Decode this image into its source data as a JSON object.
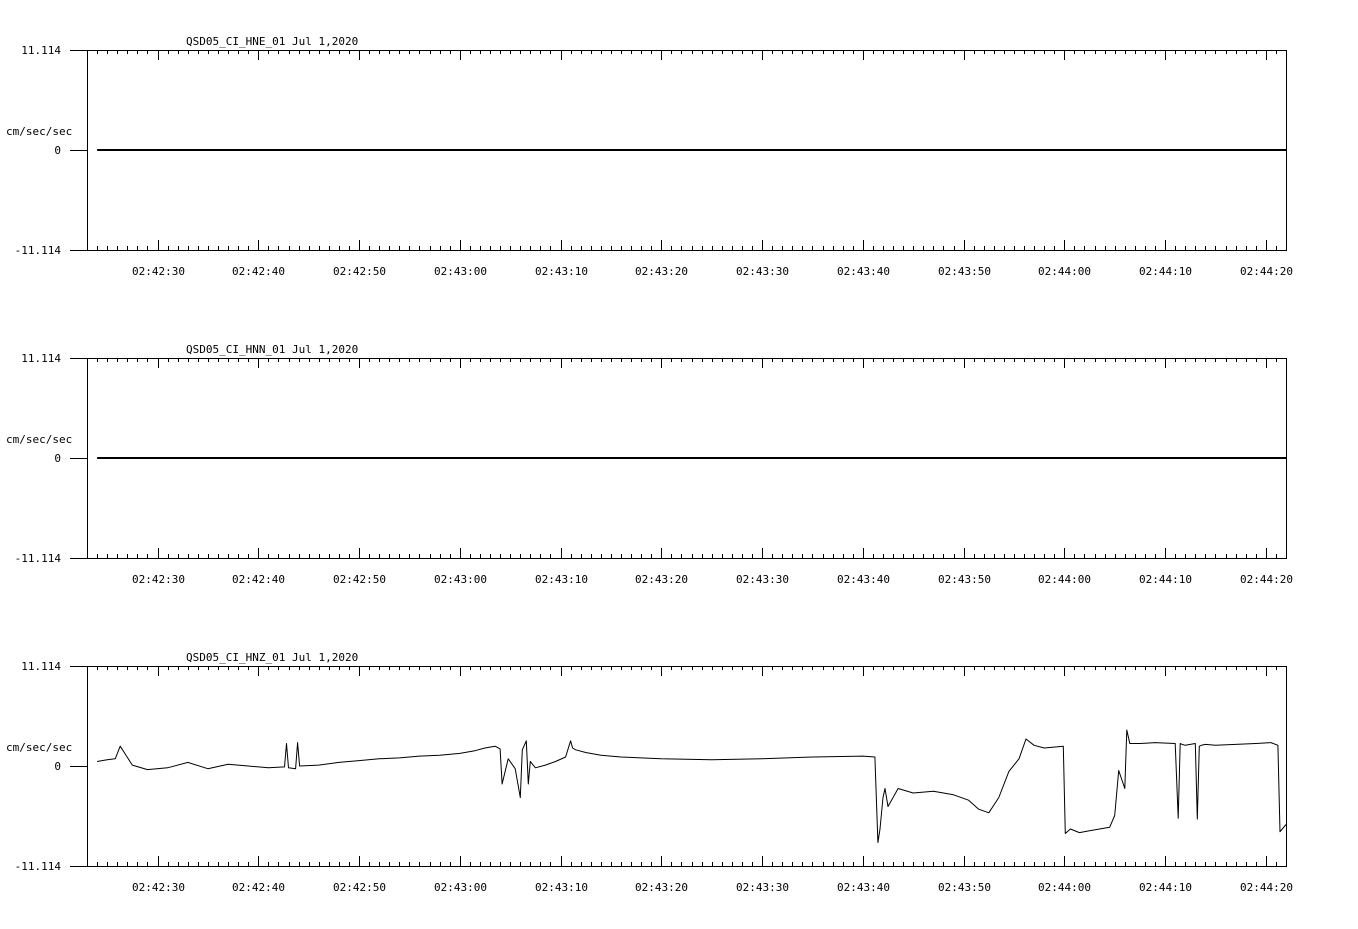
{
  "chart_data": [
    {
      "type": "line",
      "title": "QSD05_CI_HNE_01  Jul 1,2020",
      "ylabel": "cm/sec/sec",
      "ylim": [
        -11.114,
        11.114
      ],
      "ytick_labels": [
        "11.114",
        "0",
        "-11.114"
      ],
      "xlim": [
        "02:42:23",
        "02:44:22"
      ],
      "xtick_labels": [
        "02:42:30",
        "02:42:40",
        "02:42:50",
        "02:43:00",
        "02:43:10",
        "02:43:20",
        "02:43:30",
        "02:43:40",
        "02:43:50",
        "02:44:00",
        "02:44:10",
        "02:44:20"
      ],
      "grid": false,
      "series": [
        {
          "x": [
            "02:42:24",
            "02:44:22"
          ],
          "y": [
            0,
            0
          ]
        }
      ]
    },
    {
      "type": "line",
      "title": "QSD05_CI_HNN_01  Jul 1,2020",
      "ylabel": "cm/sec/sec",
      "ylim": [
        -11.114,
        11.114
      ],
      "ytick_labels": [
        "11.114",
        "0",
        "-11.114"
      ],
      "xlim": [
        "02:42:23",
        "02:44:22"
      ],
      "xtick_labels": [
        "02:42:30",
        "02:42:40",
        "02:42:50",
        "02:43:00",
        "02:43:10",
        "02:43:20",
        "02:43:30",
        "02:43:40",
        "02:43:50",
        "02:44:00",
        "02:44:10",
        "02:44:20"
      ],
      "grid": false,
      "series": [
        {
          "x": [
            "02:42:24",
            "02:44:22"
          ],
          "y": [
            0,
            0
          ]
        }
      ]
    },
    {
      "type": "line",
      "title": "QSD05_CI_HNZ_01  Jul 1,2020",
      "ylabel": "cm/sec/sec",
      "ylim": [
        -11.114,
        11.114
      ],
      "ytick_labels": [
        "11.114",
        "0",
        "-11.114"
      ],
      "xlim": [
        "02:42:23",
        "02:44:22"
      ],
      "xtick_labels": [
        "02:42:30",
        "02:42:40",
        "02:42:50",
        "02:43:00",
        "02:43:10",
        "02:43:20",
        "02:43:30",
        "02:43:40",
        "02:43:50",
        "02:44:00",
        "02:44:10",
        "02:44:20"
      ],
      "grid": false,
      "series": [
        {
          "x": [
            "02:42:24.0",
            "02:42:25.0",
            "02:42:25.8",
            "02:42:26.3",
            "02:42:27.5",
            "02:42:29",
            "02:42:31",
            "02:42:33",
            "02:42:35",
            "02:42:37",
            "02:42:39",
            "02:42:41",
            "02:42:42.6",
            "02:42:42.8",
            "02:42:43.0",
            "02:42:43.7",
            "02:42:43.9",
            "02:42:44.1",
            "02:42:46",
            "02:42:48",
            "02:42:50",
            "02:42:52",
            "02:42:54",
            "02:42:56",
            "02:42:58",
            "02:43:00",
            "02:43:01.5",
            "02:43:02.5",
            "02:43:03.5",
            "02:43:04.0",
            "02:43:04.2",
            "02:43:04.8",
            "02:43:05.5",
            "02:43:06.0",
            "02:43:06.2",
            "02:43:06.6",
            "02:43:06.8",
            "02:43:07.0",
            "02:43:07.5",
            "02:43:08.5",
            "02:43:09.5",
            "02:43:10.5",
            "02:43:11.0",
            "02:43:11.2",
            "02:43:11.5",
            "02:43:12.5",
            "02:43:14.0",
            "02:43:16",
            "02:43:20",
            "02:43:25",
            "02:43:30",
            "02:43:35",
            "02:43:40",
            "02:43:41.2",
            "02:43:41.5",
            "02:43:41.7",
            "02:43:42.0",
            "02:43:42.2",
            "02:43:42.5",
            "02:43:43.5",
            "02:43:45",
            "02:43:47",
            "02:43:49",
            "02:43:50.5",
            "02:43:51.5",
            "02:43:52.5",
            "02:43:53.5",
            "02:43:54.5",
            "02:43:55.5",
            "02:43:56.2",
            "02:43:57",
            "02:43:58",
            "02:43:59.9",
            "02:44:00.1",
            "02:44:00.6",
            "02:44:01.5",
            "02:44:02.5",
            "02:44:03.5",
            "02:44:04.5",
            "02:44:05.0",
            "02:44:05.4",
            "02:44:06.0",
            "02:44:06.2",
            "02:44:06.5",
            "02:44:07.5",
            "02:44:09",
            "02:44:11",
            "02:44:11.3",
            "02:44:11.5",
            "02:44:11.7",
            "02:44:12",
            "02:44:13",
            "02:44:13.2",
            "02:44:13.4",
            "02:44:13.6",
            "02:44:14",
            "02:44:15",
            "02:44:17",
            "02:44:19",
            "02:44:20.5",
            "02:44:21.2",
            "02:44:21.4",
            "02:44:22.0"
          ],
          "y": [
            0.5,
            0.7,
            0.8,
            2.2,
            0.1,
            -0.4,
            -0.2,
            0.4,
            -0.3,
            0.2,
            0.0,
            -0.2,
            -0.1,
            2.5,
            -0.2,
            -0.3,
            2.6,
            0.0,
            0.1,
            0.4,
            0.6,
            0.8,
            0.9,
            1.1,
            1.2,
            1.4,
            1.7,
            2.0,
            2.2,
            1.9,
            -2.0,
            0.8,
            -0.3,
            -3.5,
            1.8,
            2.8,
            -2.0,
            0.5,
            -0.2,
            0.1,
            0.5,
            1.0,
            2.8,
            2.0,
            1.8,
            1.5,
            1.2,
            1.0,
            0.8,
            0.7,
            0.8,
            1.0,
            1.1,
            1.0,
            -8.5,
            -7.0,
            -3.5,
            -2.5,
            -4.5,
            -2.5,
            -3.0,
            -2.8,
            -3.2,
            -3.8,
            -4.8,
            -5.2,
            -3.5,
            -0.6,
            0.8,
            3.0,
            2.3,
            2.0,
            2.2,
            -7.5,
            -7.0,
            -7.4,
            -7.2,
            -7.0,
            -6.8,
            -5.5,
            -0.5,
            -2.5,
            4.0,
            2.5,
            2.5,
            2.6,
            2.5,
            -5.8,
            2.5,
            2.4,
            2.3,
            2.5,
            -5.9,
            2.2,
            2.3,
            2.4,
            2.3,
            2.4,
            2.5,
            2.6,
            2.3,
            -7.3,
            -6.5
          ]
        }
      ]
    }
  ]
}
